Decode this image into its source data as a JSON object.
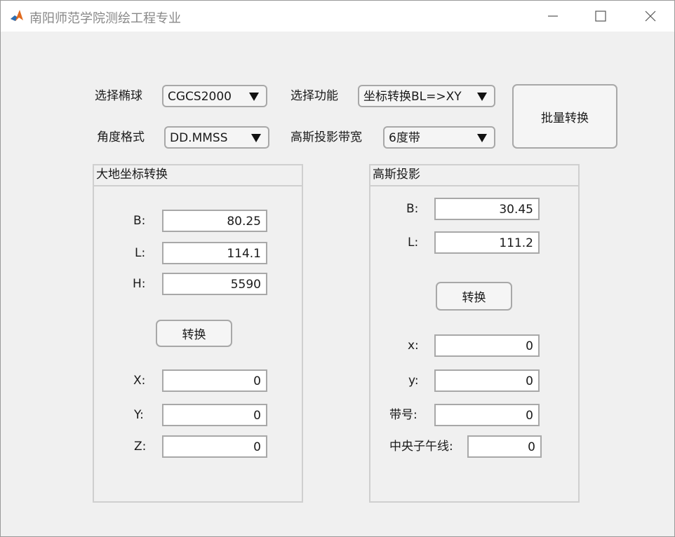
{
  "window": {
    "title": "南阳师范学院测绘工程专业",
    "icon": "matlab-icon",
    "controls": [
      "minimize-icon",
      "maximize-icon",
      "close-icon"
    ]
  },
  "toolbar": {
    "ellipsoid_label": "选择椭球",
    "ellipsoid_value": "CGCS2000",
    "function_label": "选择功能",
    "function_value": "坐标转换BL=>XY",
    "angle_label": "角度格式",
    "angle_value": "DD.MMSS",
    "zone_label": "高斯投影带宽",
    "zone_value": "6度带",
    "batch_button": "批量转换"
  },
  "geodetic_panel": {
    "title": "大地坐标转换",
    "B_label": "B:",
    "B_value": "80.25",
    "L_label": "L:",
    "L_value": "114.1",
    "H_label": "H:",
    "H_value": "5590",
    "convert_button": "转换",
    "X_label": "X:",
    "X_value": "0",
    "Y_label": "Y:",
    "Y_value": "0",
    "Z_label": "Z:",
    "Z_value": "0"
  },
  "gauss_panel": {
    "title": "高斯投影",
    "B_label": "B:",
    "B_value": "30.45",
    "L_label": "L:",
    "L_value": "111.2",
    "convert_button": "转换",
    "x_label": "x:",
    "x_value": "0",
    "y_label": "y:",
    "y_value": "0",
    "zone_label": "带号:",
    "zone_value": "0",
    "meridian_label": "中央子午线:",
    "meridian_value": "0"
  }
}
